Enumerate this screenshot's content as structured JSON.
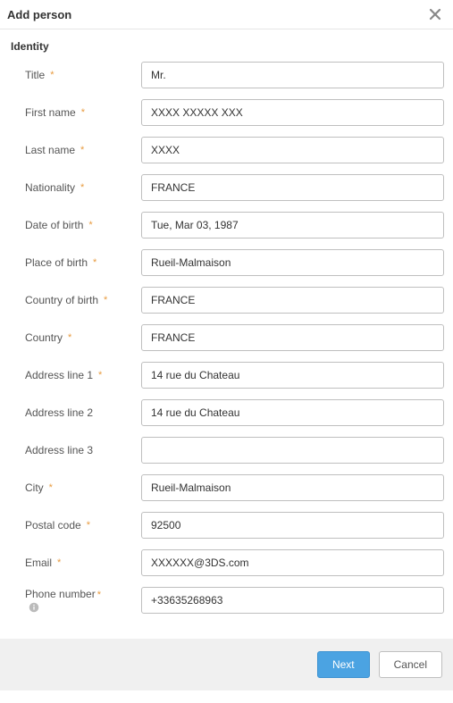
{
  "dialog": {
    "title": "Add person",
    "section": "Identity"
  },
  "fields": {
    "title": {
      "label": "Title",
      "required": true,
      "value": "Mr."
    },
    "first_name": {
      "label": "First name",
      "required": true,
      "value": "XXXX XXXXX XXX"
    },
    "last_name": {
      "label": "Last name",
      "required": true,
      "value": "XXXX"
    },
    "nationality": {
      "label": "Nationality",
      "required": true,
      "value": "FRANCE"
    },
    "date_of_birth": {
      "label": "Date of birth",
      "required": true,
      "value": "Tue, Mar 03, 1987"
    },
    "place_of_birth": {
      "label": "Place of birth",
      "required": true,
      "value": "Rueil-Malmaison"
    },
    "country_of_birth": {
      "label": "Country of birth",
      "required": true,
      "value": "FRANCE"
    },
    "country": {
      "label": "Country",
      "required": true,
      "value": "FRANCE"
    },
    "address1": {
      "label": "Address line 1",
      "required": true,
      "value": "14 rue du Chateau"
    },
    "address2": {
      "label": "Address line 2",
      "required": false,
      "value": "14 rue du Chateau"
    },
    "address3": {
      "label": "Address line 3",
      "required": false,
      "value": ""
    },
    "city": {
      "label": "City",
      "required": true,
      "value": "Rueil-Malmaison"
    },
    "postal_code": {
      "label": "Postal code",
      "required": true,
      "value": "92500"
    },
    "email": {
      "label": "Email",
      "required": true,
      "value": "XXXXXX@3DS.com"
    },
    "phone": {
      "label": "Phone number",
      "required": true,
      "value": "+33635268963",
      "info": true
    }
  },
  "footer": {
    "next": "Next",
    "cancel": "Cancel"
  },
  "asterisk": "*"
}
